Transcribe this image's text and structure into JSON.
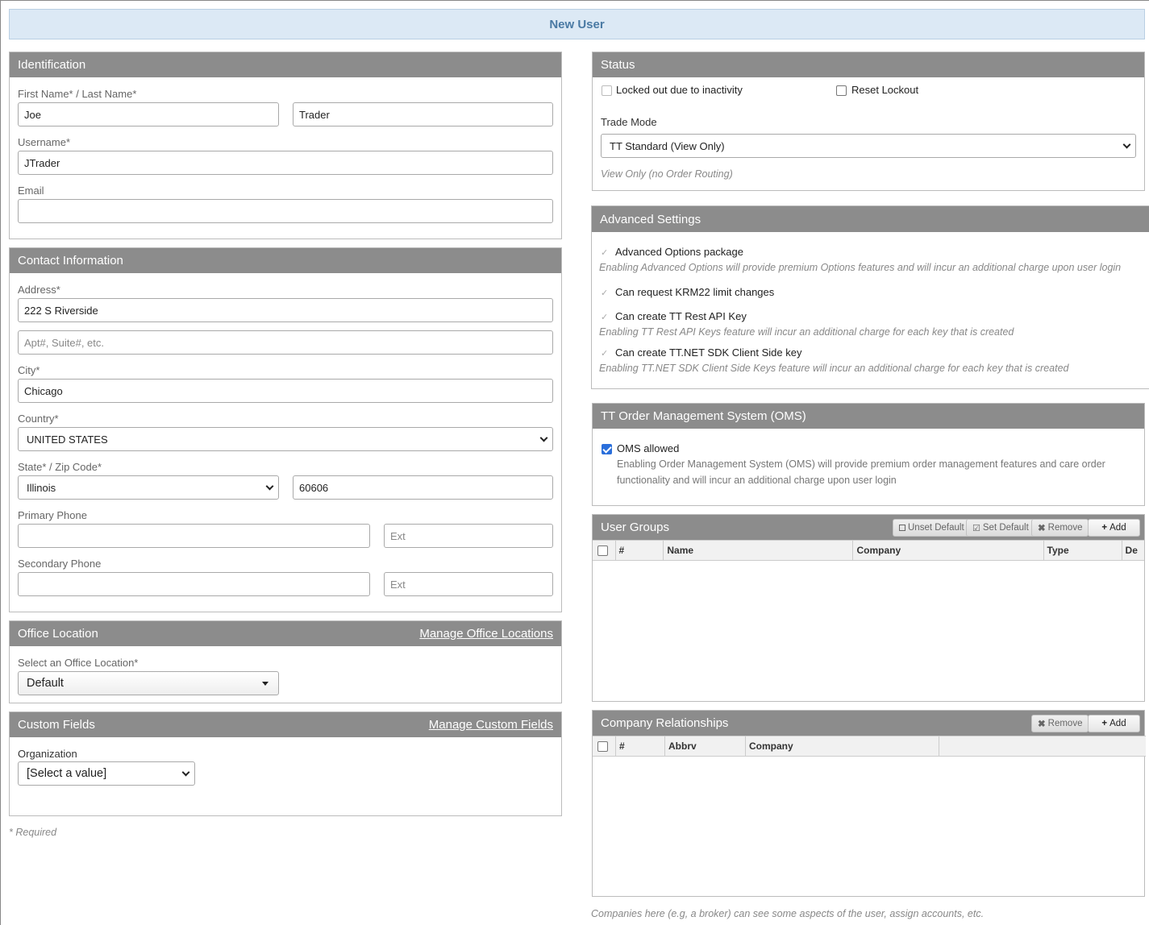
{
  "title": "New User",
  "identification": {
    "header": "Identification",
    "name_label": "First Name* / Last Name*",
    "first_name": "Joe",
    "last_name": "Trader",
    "username_label": "Username*",
    "username": "JTrader",
    "email_label": "Email",
    "email": ""
  },
  "contact": {
    "header": "Contact Information",
    "address_label": "Address*",
    "address1": "222 S Riverside",
    "address2_placeholder": "Apt#, Suite#, etc.",
    "city_label": "City*",
    "city": "Chicago",
    "country_label": "Country*",
    "country": "UNITED STATES",
    "state_zip_label": "State* / Zip Code*",
    "state": "Illinois",
    "zip": "60606",
    "primary_phone_label": "Primary Phone",
    "primary_phone": "",
    "ext_placeholder": "Ext",
    "secondary_phone_label": "Secondary Phone",
    "secondary_phone": ""
  },
  "office": {
    "header": "Office Location",
    "manage_link": "Manage Office Locations",
    "select_label": "Select an Office Location*",
    "selected": "Default"
  },
  "custom": {
    "header": "Custom Fields",
    "manage_link": "Manage Custom Fields",
    "org_label": "Organization",
    "org_selected": "[Select a value]"
  },
  "required_note": "* Required",
  "status": {
    "header": "Status",
    "locked_label": "Locked out due to inactivity",
    "locked_checked": false,
    "reset_label": "Reset Lockout",
    "reset_checked": false,
    "trade_mode_label": "Trade Mode",
    "trade_mode": "TT Standard (View Only)",
    "trade_mode_note": "View Only (no Order Routing)"
  },
  "advanced": {
    "header": "Advanced Settings",
    "items": [
      {
        "label": "Advanced Options package",
        "checked": true,
        "note": "Enabling Advanced Options will provide premium Options features and will incur an additional charge upon user login"
      },
      {
        "label": "Can request KRM22 limit changes",
        "checked": true,
        "note": ""
      },
      {
        "label": "Can create TT Rest API Key",
        "checked": true,
        "note": "Enabling TT Rest API Keys feature will incur an additional charge for each key that is created"
      },
      {
        "label": "Can create TT.NET SDK Client Side key",
        "checked": true,
        "note": "Enabling TT.NET SDK Client Side Keys feature will incur an additional charge for each key that is created"
      }
    ]
  },
  "oms": {
    "header": "TT Order Management System (OMS)",
    "label": "OMS allowed",
    "checked": true,
    "note_line1": "Enabling Order Management System (OMS) will provide premium order management features and care order",
    "note_line2": "functionality and will incur an additional charge upon user login"
  },
  "user_groups": {
    "header": "User Groups",
    "btn_unset": "Unset Default",
    "btn_set": "Set Default",
    "btn_remove": "Remove",
    "btn_add": "Add",
    "columns": [
      "#",
      "Name",
      "Company",
      "Type",
      "De"
    ]
  },
  "company_rel": {
    "header": "Company Relationships",
    "btn_remove": "Remove",
    "btn_add": "Add",
    "columns": [
      "#",
      "Abbrv",
      "Company"
    ],
    "note": "Companies here (e.g, a broker) can see some aspects of the user, assign accounts, etc."
  }
}
